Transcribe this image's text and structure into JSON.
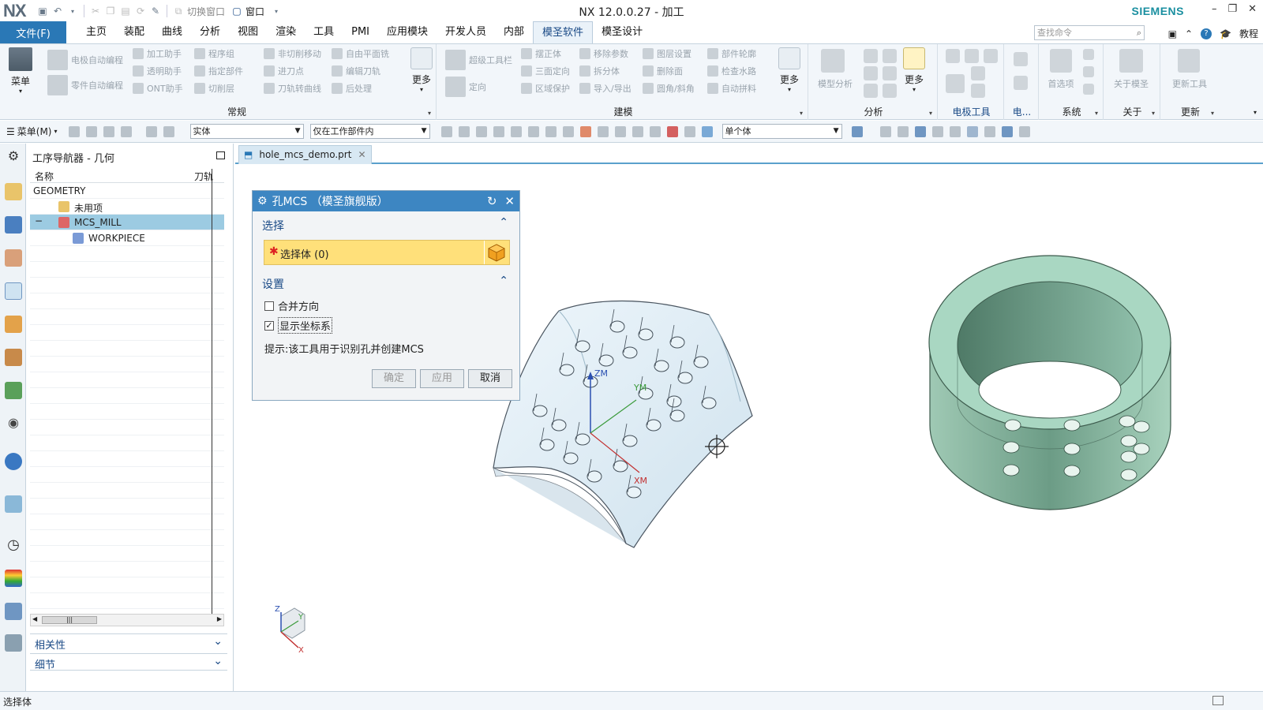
{
  "title_bar": {
    "logo": "NX",
    "quick_access": {
      "switch_window": "切换窗口",
      "window_menu": "窗口"
    },
    "app_title": "NX 12.0.0.27 - 加工",
    "brand": "SIEMENS"
  },
  "menu_bar": {
    "file_tab": "文件(F)",
    "tabs": [
      "主页",
      "装配",
      "曲线",
      "分析",
      "视图",
      "渲染",
      "工具",
      "PMI",
      "应用模块",
      "开发人员",
      "内部",
      "模圣软件",
      "模圣设计"
    ],
    "active_tab": "模圣软件",
    "search_placeholder": "查找命令",
    "help_label": "教程"
  },
  "ribbon": {
    "menu_button": "菜单",
    "groups": {
      "general": {
        "label": "常规",
        "items": [
          "电极自动编程",
          "加工助手",
          "程序组",
          "非切削移动",
          "自由平面铣",
          "零件自动编程",
          "透明助手",
          "指定部件",
          "进刀点",
          "编辑刀轨",
          "ONT助手",
          "切削层",
          "刀轨转曲线",
          "后处理"
        ],
        "more": "更多"
      },
      "modeling": {
        "label": "建模",
        "items": [
          "超级工具栏",
          "摆正体",
          "移除参数",
          "图层设置",
          "部件轮廓",
          "定向",
          "三面定向",
          "拆分体",
          "删除面",
          "检查水路",
          "区域保护",
          "导入/导出",
          "圆角/斜角",
          "自动拼料"
        ],
        "more": "更多"
      },
      "analysis": {
        "label": "分析",
        "items": [
          "模型分析"
        ],
        "more": "更多"
      },
      "electrode": {
        "label": "电极工具",
        "short": "电..."
      },
      "system": {
        "label": "系统",
        "items": [
          "首选项"
        ]
      },
      "about": {
        "label": "关于",
        "items": [
          "关于模圣"
        ]
      },
      "update": {
        "label": "更新",
        "items": [
          "更新工具"
        ]
      }
    }
  },
  "toolbar": {
    "menu_label": "菜单(M)",
    "filter_type": "实体",
    "filter_scope": "仅在工作部件内",
    "body_mode": "单个体"
  },
  "navigator": {
    "title": "工序导航器 - 几何",
    "columns": [
      "名称",
      "刀轨"
    ],
    "rows": [
      {
        "label": "GEOMETRY",
        "level": 0,
        "selected": false
      },
      {
        "label": "未用项",
        "level": 1,
        "selected": false
      },
      {
        "label": "MCS_MILL",
        "level": 1,
        "selected": true
      },
      {
        "label": "WORKPIECE",
        "level": 2,
        "selected": false
      }
    ],
    "panels": [
      "相关性",
      "细节"
    ]
  },
  "document": {
    "tab": "hole_mcs_demo.prt"
  },
  "dialog": {
    "title": "孔MCS （模圣旗舰版）",
    "section_select": "选择",
    "select_body": "选择体 (0)",
    "section_settings": "设置",
    "merge_direction": "合并方向",
    "merge_direction_checked": false,
    "show_csys": "显示坐标系",
    "show_csys_checked": true,
    "hint": "提示:该工具用于识别孔并创建MCS",
    "ok": "确定",
    "apply": "应用",
    "cancel": "取消"
  },
  "viewport": {
    "axis_labels": {
      "zm": "ZM",
      "ym": "YM",
      "xm": "XM"
    },
    "triad": {
      "x": "X",
      "y": "Y",
      "z": "Z"
    }
  },
  "status_bar": {
    "text": "选择体"
  }
}
